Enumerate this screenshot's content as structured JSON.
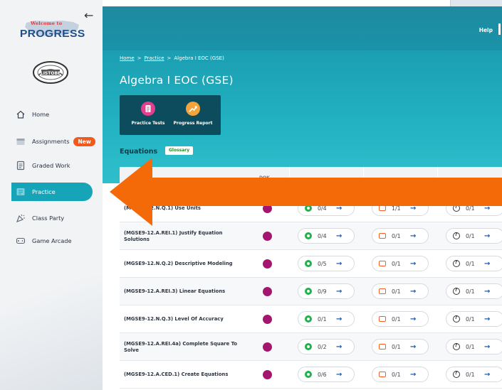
{
  "sidebar": {
    "logo": {
      "welcome": "Welcome to",
      "title": "PROGRESS"
    },
    "school_logo": "LISTOBE",
    "items": [
      {
        "label": "Home",
        "icon": "home-icon"
      },
      {
        "label": "Assignments",
        "icon": "assignments-icon",
        "badge": "New"
      },
      {
        "label": "Graded Work",
        "icon": "graded-work-icon"
      },
      {
        "label": "Practice",
        "icon": "practice-icon",
        "active": true
      },
      {
        "label": "Class Party",
        "icon": "class-party-icon"
      },
      {
        "label": "Game Arcade",
        "icon": "game-arcade-icon"
      }
    ]
  },
  "header": {
    "help": "Help"
  },
  "breadcrumb": {
    "home": "Home",
    "practice": "Practice",
    "sep": ">",
    "current": "Algebra I EOC (GSE)"
  },
  "page": {
    "title": "Algebra I EOC (GSE)",
    "tools": [
      {
        "label": "Practice Tests",
        "icon": "practice-tests-icon"
      },
      {
        "label": "Progress Report",
        "icon": "progress-report-icon"
      }
    ],
    "section": "Equations",
    "glossary": "Glossary"
  },
  "table": {
    "header_partial": "DOK",
    "rows": [
      {
        "standard": "(MGSE9-12.N.Q.1) Use Units",
        "practice": "0/4",
        "quiz": "1/1",
        "test": "0/1"
      },
      {
        "standard": "(MGSE9-12.A.REI.1) Justify Equation Solutions",
        "practice": "0/4",
        "quiz": "0/1",
        "test": "0/1"
      },
      {
        "standard": "(MGSE9-12.N.Q.2) Descriptive Modeling",
        "practice": "0/5",
        "quiz": "0/1",
        "test": "0/1"
      },
      {
        "standard": "(MGSE9-12.A.REI.3) Linear Equations",
        "practice": "0/9",
        "quiz": "0/1",
        "test": "0/1"
      },
      {
        "standard": "(MGSE9-12.N.Q.3) Level Of Accuracy",
        "practice": "0/1",
        "quiz": "0/1",
        "test": "0/1"
      },
      {
        "standard": "(MGSE9-12.A.REI.4a) Complete Square To Solve",
        "practice": "0/2",
        "quiz": "0/1",
        "test": "0/1"
      },
      {
        "standard": "(MGSE9-12.A.CED.1) Create Equations",
        "practice": "0/6",
        "quiz": "0/1",
        "test": "0/1"
      }
    ],
    "arrow_glyph": "→"
  },
  "colors": {
    "accent": "#16a5b8",
    "header": "#1e8aa0",
    "dot": "#a3156e",
    "badge": "#f05a1c",
    "overlay_arrow": "#f56a08"
  }
}
